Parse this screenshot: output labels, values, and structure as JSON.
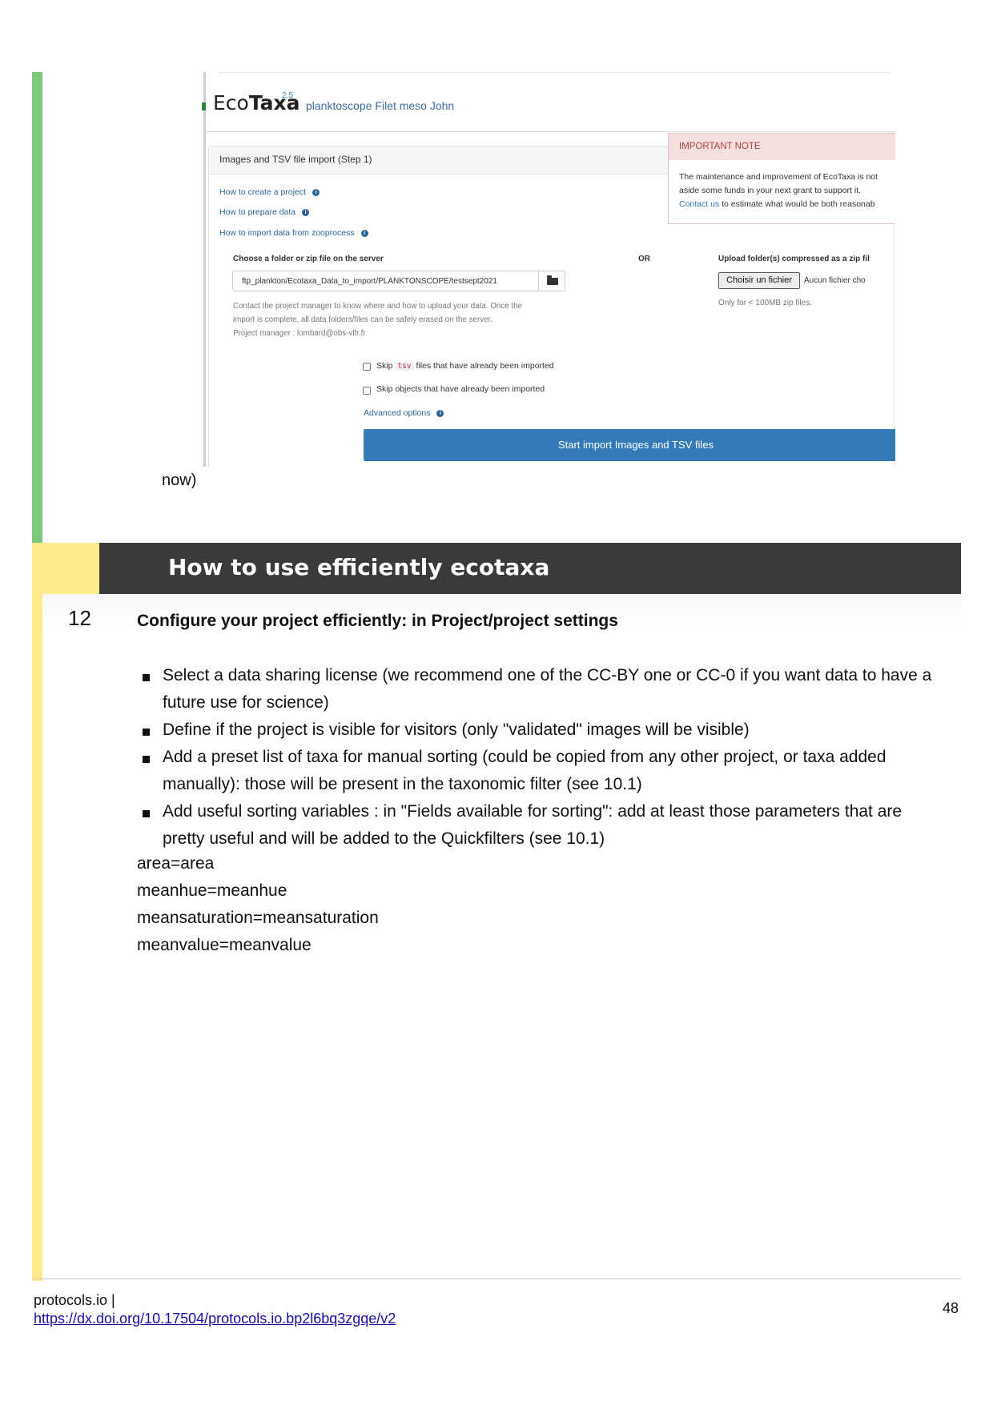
{
  "screenshot": {
    "logo_eco": "Eco",
    "logo_taxa": "Taxa",
    "logo_version": "2.5",
    "project_title": "planktoscope Filet meso John",
    "panel_title": "Images and TSV file import (Step 1)",
    "important_note": {
      "title": "IMPORTANT NOTE",
      "line1": "The maintenance and improvement of EcoTaxa is not",
      "line2": "aside some funds in your next grant to support it.",
      "link": "Contact us",
      "line3_rest": " to estimate what would be both reasonab"
    },
    "help_links": [
      "How to create a project",
      "How to prepare data",
      "How to import data from zooprocess"
    ],
    "choose_label": "Choose a folder or zip file on the server",
    "or_label": "OR",
    "upload_label": "Upload folder(s) compressed as a zip fil",
    "server_path": "ftp_plankton/Ecotaxa_Data_to_import/PLANKTONSCOPE/testsept2021",
    "file_button": "Choisir un fichier",
    "file_none": "Aucun fichier cho",
    "upload_help": "Only for < 100MB zip files.",
    "server_help_1": "Contact the project manager to know where and how to upload your data. Once the",
    "server_help_2": "import is complete, all data folders/files can be safely erased on the server.",
    "server_help_3": "Project manager : lombard@obs-vlfr.fr",
    "skip_tsv_before": "Skip",
    "skip_tsv_code": "tsv",
    "skip_tsv_after": "files that have already been imported",
    "skip_objects": "Skip objects that have already been imported",
    "advanced": "Advanced options",
    "start_button": "Start import Images and TSV files"
  },
  "now_text": "now)",
  "section_title": "How to use efficiently ecotaxa",
  "step": {
    "number": "12",
    "title": "Configure your project efficiently:  in Project/project settings",
    "bullets": [
      "Select a data sharing license (we recommend one of the CC-BY one or CC-0 if you want data to have a future use for science)",
      "Define if the project is visible for visitors (only \"validated\" images will be visible)",
      "Add a preset list of taxa for manual sorting (could be copied from any other project, or taxa added manually): those will be present in the taxonomic filter (see 10.1)",
      "Add useful sorting variables : in \"Fields available for sorting\": add at least those parameters that are pretty useful and will be added to the Quickfilters (see 10.1)"
    ],
    "params": [
      "area=area",
      "meanhue=meanhue",
      "meansaturation=meansaturation",
      "meanvalue=meanvalue"
    ]
  },
  "footer": {
    "site": "protocols.io |",
    "link": "https://dx.doi.org/10.17504/protocols.io.bp2l6bq3zgqe/v2",
    "page": "48"
  }
}
